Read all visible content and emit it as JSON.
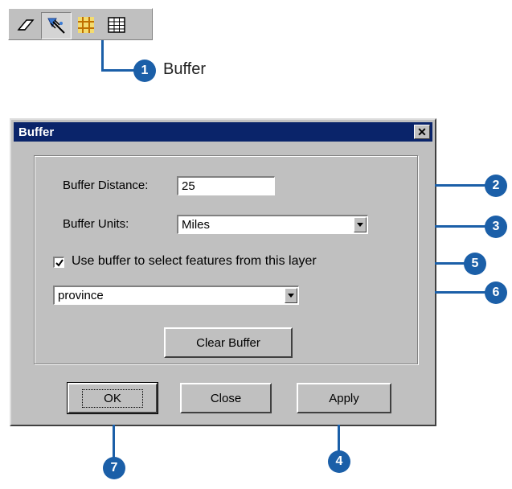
{
  "toolbar": {
    "buttons": [
      {
        "icon": "eraser-icon"
      },
      {
        "icon": "select-features-icon"
      },
      {
        "icon": "buffer-icon"
      },
      {
        "icon": "table-icon"
      }
    ]
  },
  "callouts": {
    "1": {
      "number": "1",
      "text": "Buffer"
    },
    "2": {
      "number": "2"
    },
    "3": {
      "number": "3"
    },
    "4": {
      "number": "4"
    },
    "5": {
      "number": "5"
    },
    "6": {
      "number": "6"
    },
    "7": {
      "number": "7"
    }
  },
  "dialog": {
    "title": "Buffer",
    "close_symbol": "✕",
    "buffer_distance_label": "Buffer Distance:",
    "buffer_distance_value": "25",
    "buffer_units_label": "Buffer Units:",
    "buffer_units_value": "Miles",
    "use_buffer_label": "Use buffer to select features from this layer",
    "use_buffer_checked": true,
    "layer_value": "province",
    "clear_buffer_label": "Clear Buffer",
    "ok_label": "OK",
    "close_label": "Close",
    "apply_label": "Apply"
  },
  "colors": {
    "callout": "#1b5fa8",
    "titlebar": "#0a246a",
    "dialog_bg": "#c0c0c0"
  }
}
